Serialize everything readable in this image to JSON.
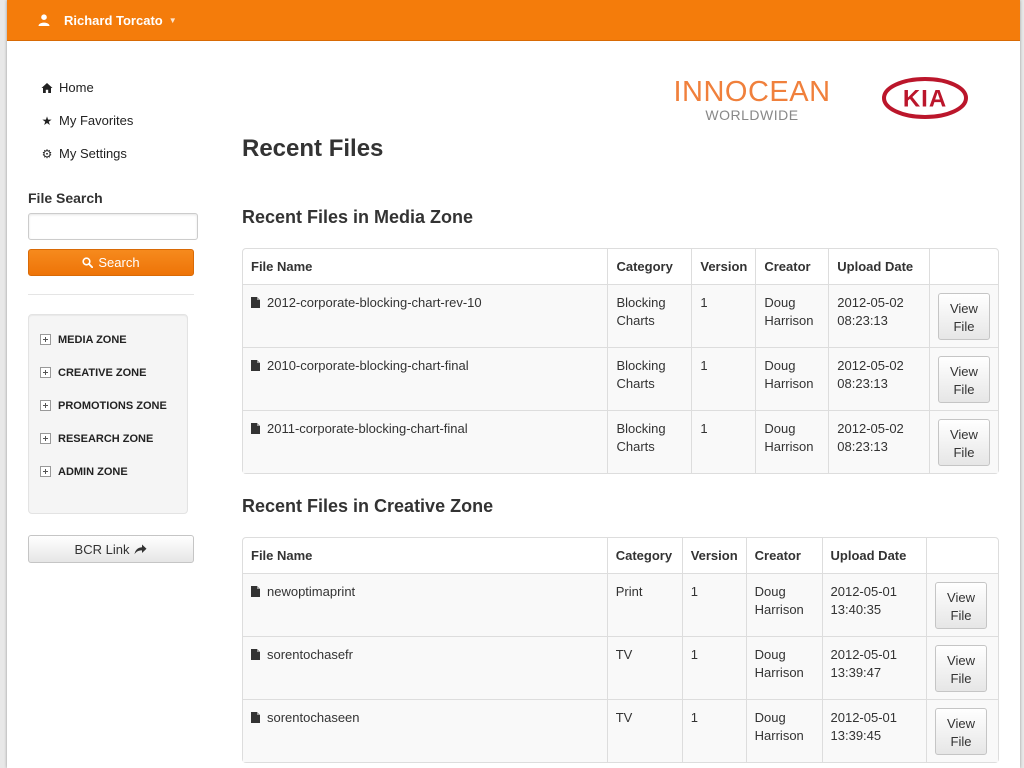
{
  "topbar": {
    "user_name": "Richard Torcato",
    "user_icon": "user-icon"
  },
  "sidebar": {
    "nav": [
      {
        "label": "Home",
        "icon": "home-icon"
      },
      {
        "label": "My Favorites",
        "icon": "star-icon"
      },
      {
        "label": "My Settings",
        "icon": "gear-icon"
      }
    ],
    "search_label": "File Search",
    "search_value": "",
    "search_button": "Search",
    "zones": [
      "MEDIA ZONE",
      "CREATIVE ZONE",
      "PROMOTIONS ZONE",
      "RESEARCH ZONE",
      "ADMIN ZONE"
    ],
    "bcr_link": "BCR Link"
  },
  "logos": {
    "innocean": "INNOCEAN",
    "innocean_sub": "WORLDWIDE",
    "kia": "KIA"
  },
  "colors": {
    "accent": "#f47c0b",
    "kia_red": "#bb162b",
    "innocean_orange": "#f0803c"
  },
  "main": {
    "page_title": "Recent Files",
    "sections": [
      {
        "title": "Recent Files in Media Zone",
        "headers": [
          "File Name",
          "Category",
          "Version",
          "Creator",
          "Upload Date",
          ""
        ],
        "rows": [
          {
            "file_name": "2012-corporate-blocking-chart-rev-10",
            "category": [
              "Blocking",
              "Charts"
            ],
            "version": "1",
            "creator": [
              "Doug",
              "Harrison"
            ],
            "upload_date": [
              "2012-05-02",
              "08:23:13"
            ],
            "action": [
              "View",
              "File"
            ]
          },
          {
            "file_name": "2010-corporate-blocking-chart-final",
            "category": [
              "Blocking",
              "Charts"
            ],
            "version": "1",
            "creator": [
              "Doug",
              "Harrison"
            ],
            "upload_date": [
              "2012-05-02",
              "08:23:13"
            ],
            "action": [
              "View",
              "File"
            ]
          },
          {
            "file_name": "2011-corporate-blocking-chart-final",
            "category": [
              "Blocking",
              "Charts"
            ],
            "version": "1",
            "creator": [
              "Doug",
              "Harrison"
            ],
            "upload_date": [
              "2012-05-02",
              "08:23:13"
            ],
            "action": [
              "View",
              "File"
            ]
          }
        ]
      },
      {
        "title": "Recent Files in Creative Zone",
        "headers": [
          "File Name",
          "Category",
          "Version",
          "Creator",
          "Upload Date",
          ""
        ],
        "rows": [
          {
            "file_name": "newoptimaprint",
            "category": [
              "Print",
              ""
            ],
            "version": "1",
            "creator": [
              "Doug",
              "Harrison"
            ],
            "upload_date": [
              "2012-05-01",
              "13:40:35"
            ],
            "action": [
              "View",
              "File"
            ]
          },
          {
            "file_name": "sorentochasefr",
            "category": [
              "TV",
              ""
            ],
            "version": "1",
            "creator": [
              "Doug",
              "Harrison"
            ],
            "upload_date": [
              "2012-05-01",
              "13:39:47"
            ],
            "action": [
              "View",
              "File"
            ]
          },
          {
            "file_name": "sorentochaseen",
            "category": [
              "TV",
              ""
            ],
            "version": "1",
            "creator": [
              "Doug",
              "Harrison"
            ],
            "upload_date": [
              "2012-05-01",
              "13:39:45"
            ],
            "action": [
              "View",
              "File"
            ]
          }
        ]
      }
    ]
  }
}
